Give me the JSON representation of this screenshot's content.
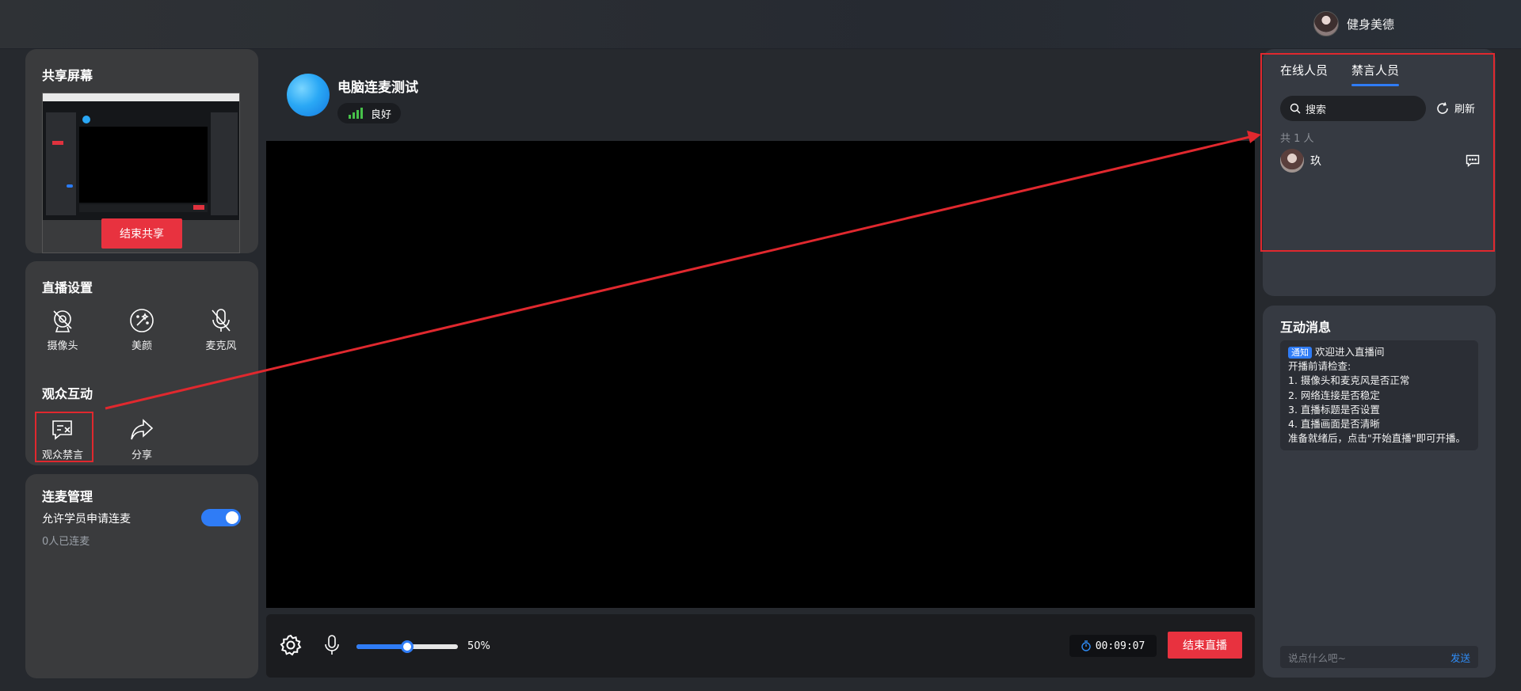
{
  "header": {
    "user_name": "健身美德"
  },
  "share": {
    "title": "共享屏幕",
    "end_button": "结束共享"
  },
  "live_settings": {
    "title": "直播设置",
    "items": [
      {
        "icon": "camera-icon",
        "label": "摄像头"
      },
      {
        "icon": "beauty-icon",
        "label": "美颜"
      },
      {
        "icon": "microphone-muted-icon",
        "label": "麦克风"
      }
    ]
  },
  "audience": {
    "title": "观众互动",
    "items": [
      {
        "icon": "mute-message-icon",
        "label": "观众禁言"
      },
      {
        "icon": "share-icon",
        "label": "分享"
      }
    ]
  },
  "link_mic": {
    "title": "连麦管理",
    "allow_label": "允许学员申请连麦",
    "allow_enabled": true,
    "connected_count": "0人已连麦"
  },
  "room": {
    "title": "电脑连麦测试",
    "network_status": "良好"
  },
  "controls": {
    "volume_percent_label": "50%",
    "volume_value": 0.5,
    "timer": "00:09:07",
    "end_live_button": "结束直播"
  },
  "people": {
    "tabs": [
      {
        "label": "在线人员",
        "active": false
      },
      {
        "label": "禁言人员",
        "active": true
      }
    ],
    "search_placeholder": "搜索",
    "refresh_label": "刷新",
    "count_label": "共 1 人",
    "members": [
      {
        "name": "玖"
      }
    ]
  },
  "chat": {
    "title": "互动消息",
    "notice_tag": "通知",
    "notice_title": "欢迎进入直播间",
    "lines": [
      "开播前请检查:",
      "1. 摄像头和麦克风是否正常",
      "2. 网络连接是否稳定",
      "3. 直播标题是否设置",
      "4. 直播画面是否清晰",
      "准备就绪后，点击\"开始直播\"即可开播。"
    ],
    "input_placeholder": "说点什么吧~",
    "send_label": "发送"
  },
  "colors": {
    "accent_blue": "#2f7cf6",
    "danger_red": "#e8323f",
    "annotation_red": "#e0282e"
  }
}
